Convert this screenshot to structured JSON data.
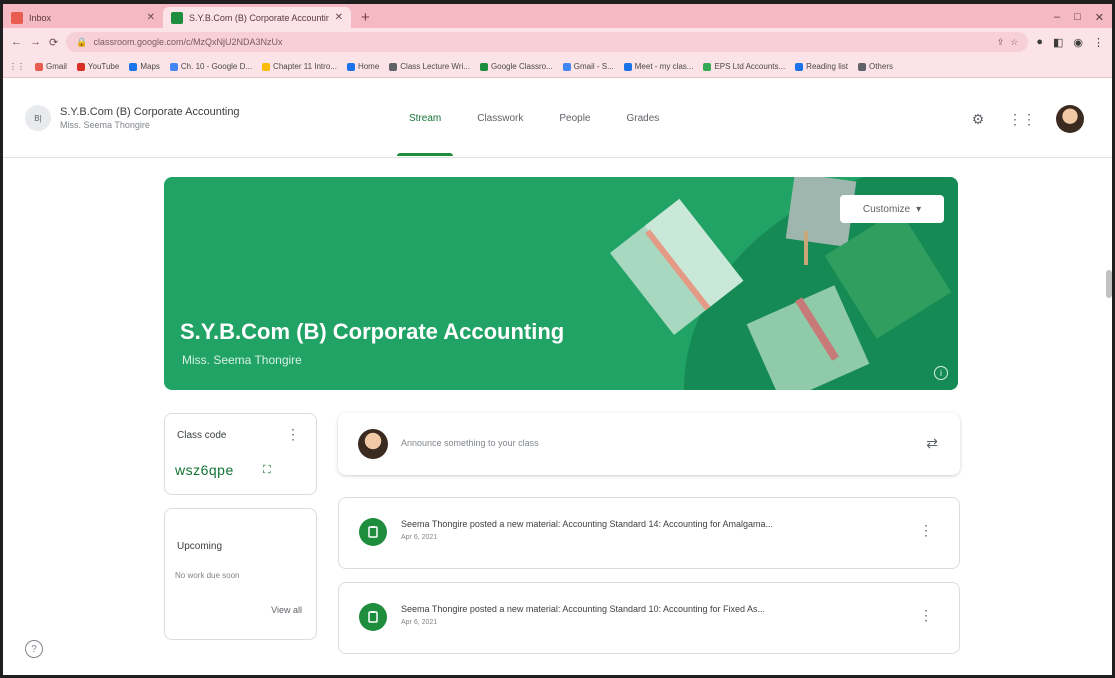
{
  "browser": {
    "tabs": [
      {
        "title": "Inbox",
        "active": false,
        "favicon_color": "#e85d4f"
      },
      {
        "title": "S.Y.B.Com (B) Corporate Accounting",
        "active": true,
        "favicon_color": "#1e8e3e"
      }
    ],
    "new_tab_label": "+",
    "window_controls": [
      "–",
      "□",
      "✕"
    ],
    "url": "classroom.google.com/c/MzQxNjU2NDA3NzUx",
    "bookmarks": [
      {
        "label": "Gmail",
        "color": "#e85d4f"
      },
      {
        "label": "YouTube",
        "color": "#d93025"
      },
      {
        "label": "Maps",
        "color": "#1a73e8"
      },
      {
        "label": "Ch. 10 - Google D...",
        "color": "#4285f4"
      },
      {
        "label": "Chapter 11 Intro...",
        "color": "#fbbc04"
      },
      {
        "label": "Home",
        "color": "#1a73e8"
      },
      {
        "label": "Class Lecture Wri...",
        "color": "#5f6368"
      },
      {
        "label": "Google Classro...",
        "color": "#1e8e3e"
      },
      {
        "label": "Gmail - S...",
        "color": "#4285f4"
      },
      {
        "label": "Meet - my clas...",
        "color": "#1a73e8"
      },
      {
        "label": "EPS Ltd Accounts...",
        "color": "#34a853"
      },
      {
        "label": "Reading list",
        "color": "#1a73e8"
      },
      {
        "label": "Others",
        "color": "#5f6368"
      }
    ]
  },
  "classroom": {
    "class_icon_text": "B|",
    "class_name": "S.Y.B.Com (B) Corporate Accounting",
    "teacher": "Miss. Seema Thongire",
    "nav": [
      {
        "label": "Stream",
        "active": true
      },
      {
        "label": "Classwork",
        "active": false
      },
      {
        "label": "People",
        "active": false
      },
      {
        "label": "Grades",
        "active": false
      }
    ],
    "banner": {
      "title": "S.Y.B.Com (B) Corporate Accounting",
      "subtitle": "Miss. Seema Thongire",
      "customize_label": "Customize",
      "color": "#21a366"
    },
    "class_code": {
      "label": "Class code",
      "code": "wsz6qpe"
    },
    "upcoming": {
      "label": "Upcoming",
      "empty_text": "No work due soon",
      "view_all_label": "View all"
    },
    "compose_placeholder": "Announce something to your class",
    "posts": [
      {
        "title": "Seema Thongire posted a new material: Accounting Standard 14: Accounting for Amalgama...",
        "date": "Apr 6, 2021"
      },
      {
        "title": "Seema Thongire posted a new material: Accounting Standard 10: Accounting for Fixed As...",
        "date": "Apr 6, 2021"
      }
    ]
  }
}
